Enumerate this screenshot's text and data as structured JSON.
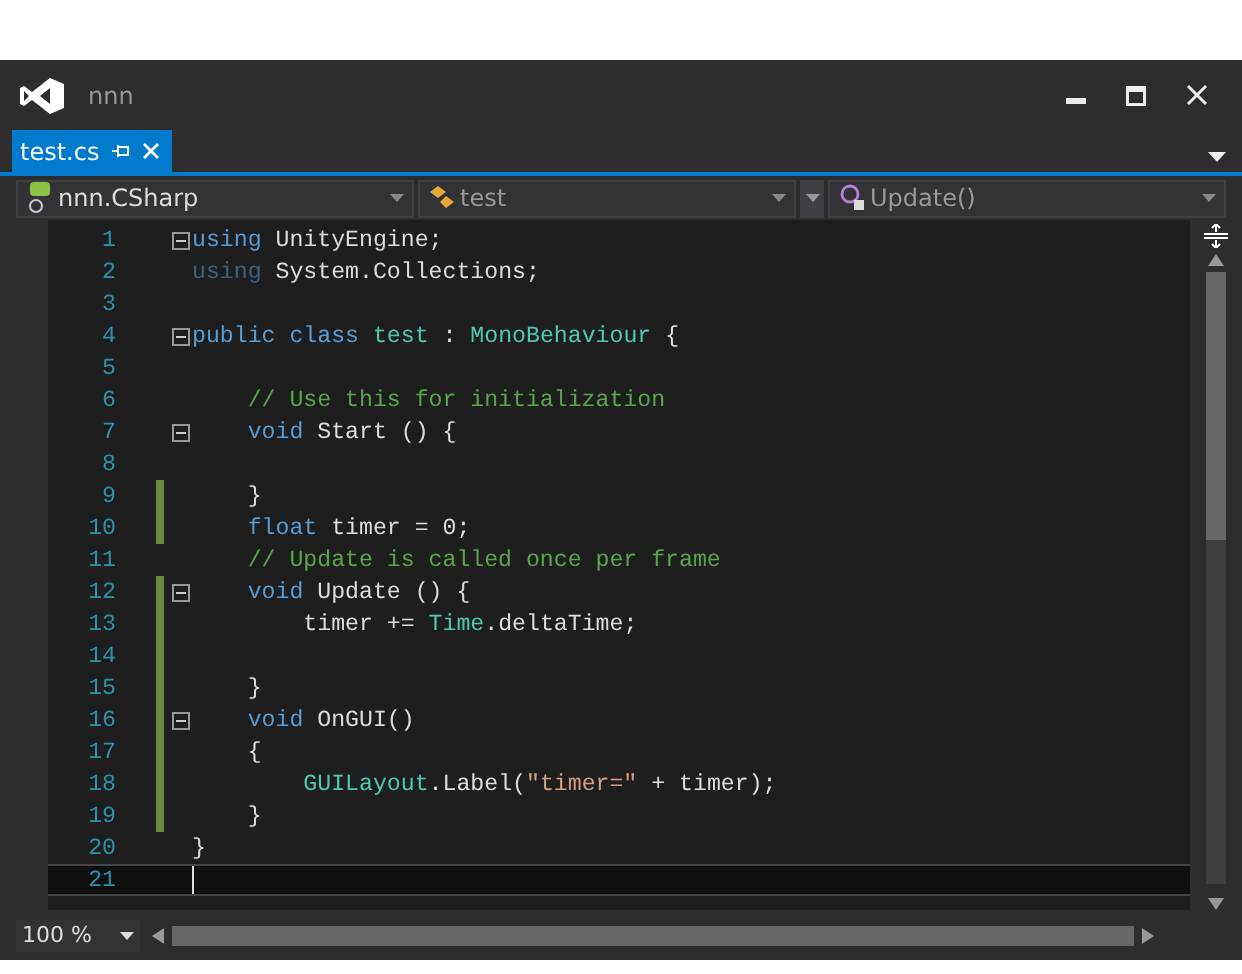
{
  "window": {
    "title": "nnn"
  },
  "tabs": [
    {
      "label": "test.cs",
      "selected": true
    }
  ],
  "nav": [
    {
      "kind": "project",
      "label": "nnn.CSharp"
    },
    {
      "kind": "class",
      "label": "test"
    },
    {
      "kind": "method",
      "label": "Update()"
    }
  ],
  "lines": [
    {
      "number": "1",
      "fold": true,
      "changed": false,
      "current": false,
      "tokens": [
        {
          "kind": "keyword",
          "text": "using"
        },
        {
          "kind": "plain",
          "text": " UnityEngine;"
        }
      ]
    },
    {
      "number": "2",
      "fold": false,
      "changed": false,
      "current": false,
      "tokens": [
        {
          "kind": "unused",
          "text": "using"
        },
        {
          "kind": "plain",
          "text": " System.Collections;"
        }
      ]
    },
    {
      "number": "3",
      "fold": false,
      "changed": false,
      "current": false
    },
    {
      "number": "4",
      "fold": true,
      "changed": false,
      "current": false,
      "tokens": [
        {
          "kind": "keyword",
          "text": "public class"
        },
        {
          "kind": "type",
          "text": " test"
        },
        {
          "kind": "plain",
          "text": " : "
        },
        {
          "kind": "type",
          "text": "MonoBehaviour"
        },
        {
          "kind": "plain",
          "text": " {"
        }
      ]
    },
    {
      "number": "5",
      "fold": false,
      "changed": false,
      "current": false
    },
    {
      "number": "6",
      "fold": false,
      "changed": false,
      "current": false,
      "tokens": [
        {
          "kind": "comment",
          "text": "    // Use this for initialization"
        }
      ]
    },
    {
      "number": "7",
      "fold": true,
      "changed": false,
      "current": false,
      "tokens": [
        {
          "kind": "keyword",
          "text": "    void"
        },
        {
          "kind": "plain",
          "text": " Start () {"
        }
      ]
    },
    {
      "number": "8",
      "fold": false,
      "changed": false,
      "current": false
    },
    {
      "number": "9",
      "fold": false,
      "changed": true,
      "current": false,
      "tokens": [
        {
          "kind": "plain",
          "text": "    }"
        }
      ]
    },
    {
      "number": "10",
      "fold": false,
      "changed": true,
      "current": false,
      "tokens": [
        {
          "kind": "keyword",
          "text": "    float"
        },
        {
          "kind": "plain",
          "text": " timer = 0;"
        }
      ]
    },
    {
      "number": "11",
      "fold": false,
      "changed": false,
      "current": false,
      "tokens": [
        {
          "kind": "comment",
          "text": "    // Update is called once per frame"
        }
      ]
    },
    {
      "number": "12",
      "fold": true,
      "changed": true,
      "current": false,
      "tokens": [
        {
          "kind": "keyword",
          "text": "    void"
        },
        {
          "kind": "plain",
          "text": " Update () {"
        }
      ]
    },
    {
      "number": "13",
      "fold": false,
      "changed": true,
      "current": false,
      "tokens": [
        {
          "kind": "plain",
          "text": "        timer += "
        },
        {
          "kind": "type",
          "text": "Time"
        },
        {
          "kind": "plain",
          "text": ".deltaTime;"
        }
      ]
    },
    {
      "number": "14",
      "fold": false,
      "changed": true,
      "current": false
    },
    {
      "number": "15",
      "fold": false,
      "changed": true,
      "current": false,
      "tokens": [
        {
          "kind": "plain",
          "text": "    }"
        }
      ]
    },
    {
      "number": "16",
      "fold": true,
      "changed": true,
      "current": false,
      "tokens": [
        {
          "kind": "keyword",
          "text": "    void"
        },
        {
          "kind": "plain",
          "text": " OnGUI()"
        }
      ]
    },
    {
      "number": "17",
      "fold": false,
      "changed": true,
      "current": false,
      "tokens": [
        {
          "kind": "plain",
          "text": "    {"
        }
      ]
    },
    {
      "number": "18",
      "fold": false,
      "changed": true,
      "current": false,
      "tokens": [
        {
          "kind": "type",
          "text": "        GUILayout"
        },
        {
          "kind": "plain",
          "text": ".Label("
        },
        {
          "kind": "string",
          "text": "\"timer=\""
        },
        {
          "kind": "plain",
          "text": " + timer);"
        }
      ]
    },
    {
      "number": "19",
      "fold": false,
      "changed": true,
      "current": false,
      "tokens": [
        {
          "kind": "plain",
          "text": "    }"
        }
      ]
    },
    {
      "number": "20",
      "fold": false,
      "changed": false,
      "current": false,
      "tokens": [
        {
          "kind": "plain",
          "text": "}"
        }
      ]
    },
    {
      "number": "21",
      "fold": false,
      "changed": false,
      "current": true
    }
  ],
  "zoom": {
    "value": "100 %"
  }
}
